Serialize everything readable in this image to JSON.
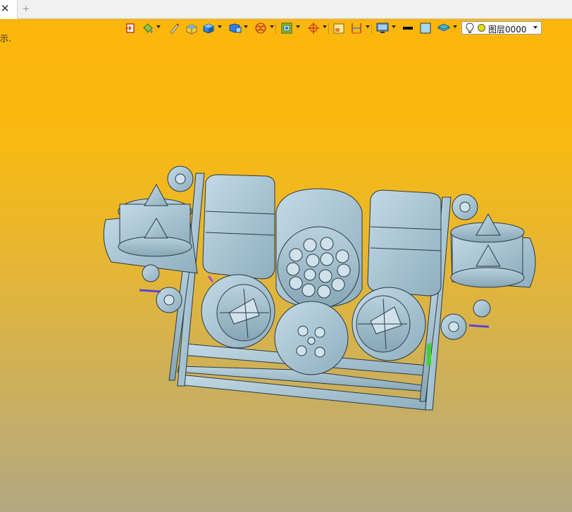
{
  "tabbar": {
    "close_label": "✕",
    "add_label": "+"
  },
  "viewport": {
    "hint_text": "示."
  },
  "toolbar": {
    "icons": [
      "exit-sketch-icon",
      "fill-bucket-icon",
      "pen-icon",
      "box-icon",
      "solid-cube-icon",
      "view-cube-icon",
      "wireframe-sphere-icon",
      "shaded-frame-icon",
      "triad-icon",
      "display-mode-icon",
      "dimension-icon",
      "monitor-icon",
      "line-color-icon",
      "fill-color-icon",
      "layer-stack-icon"
    ],
    "layer_selector": {
      "value": "图层0000",
      "bulb_icon": "lightbulb-icon",
      "color": "#e3e000"
    }
  },
  "colors": {
    "background_top": "#fdb60a",
    "background_bottom": "#b4a882",
    "model": "#a8c4d2",
    "model_dark": "#7a96a6"
  }
}
